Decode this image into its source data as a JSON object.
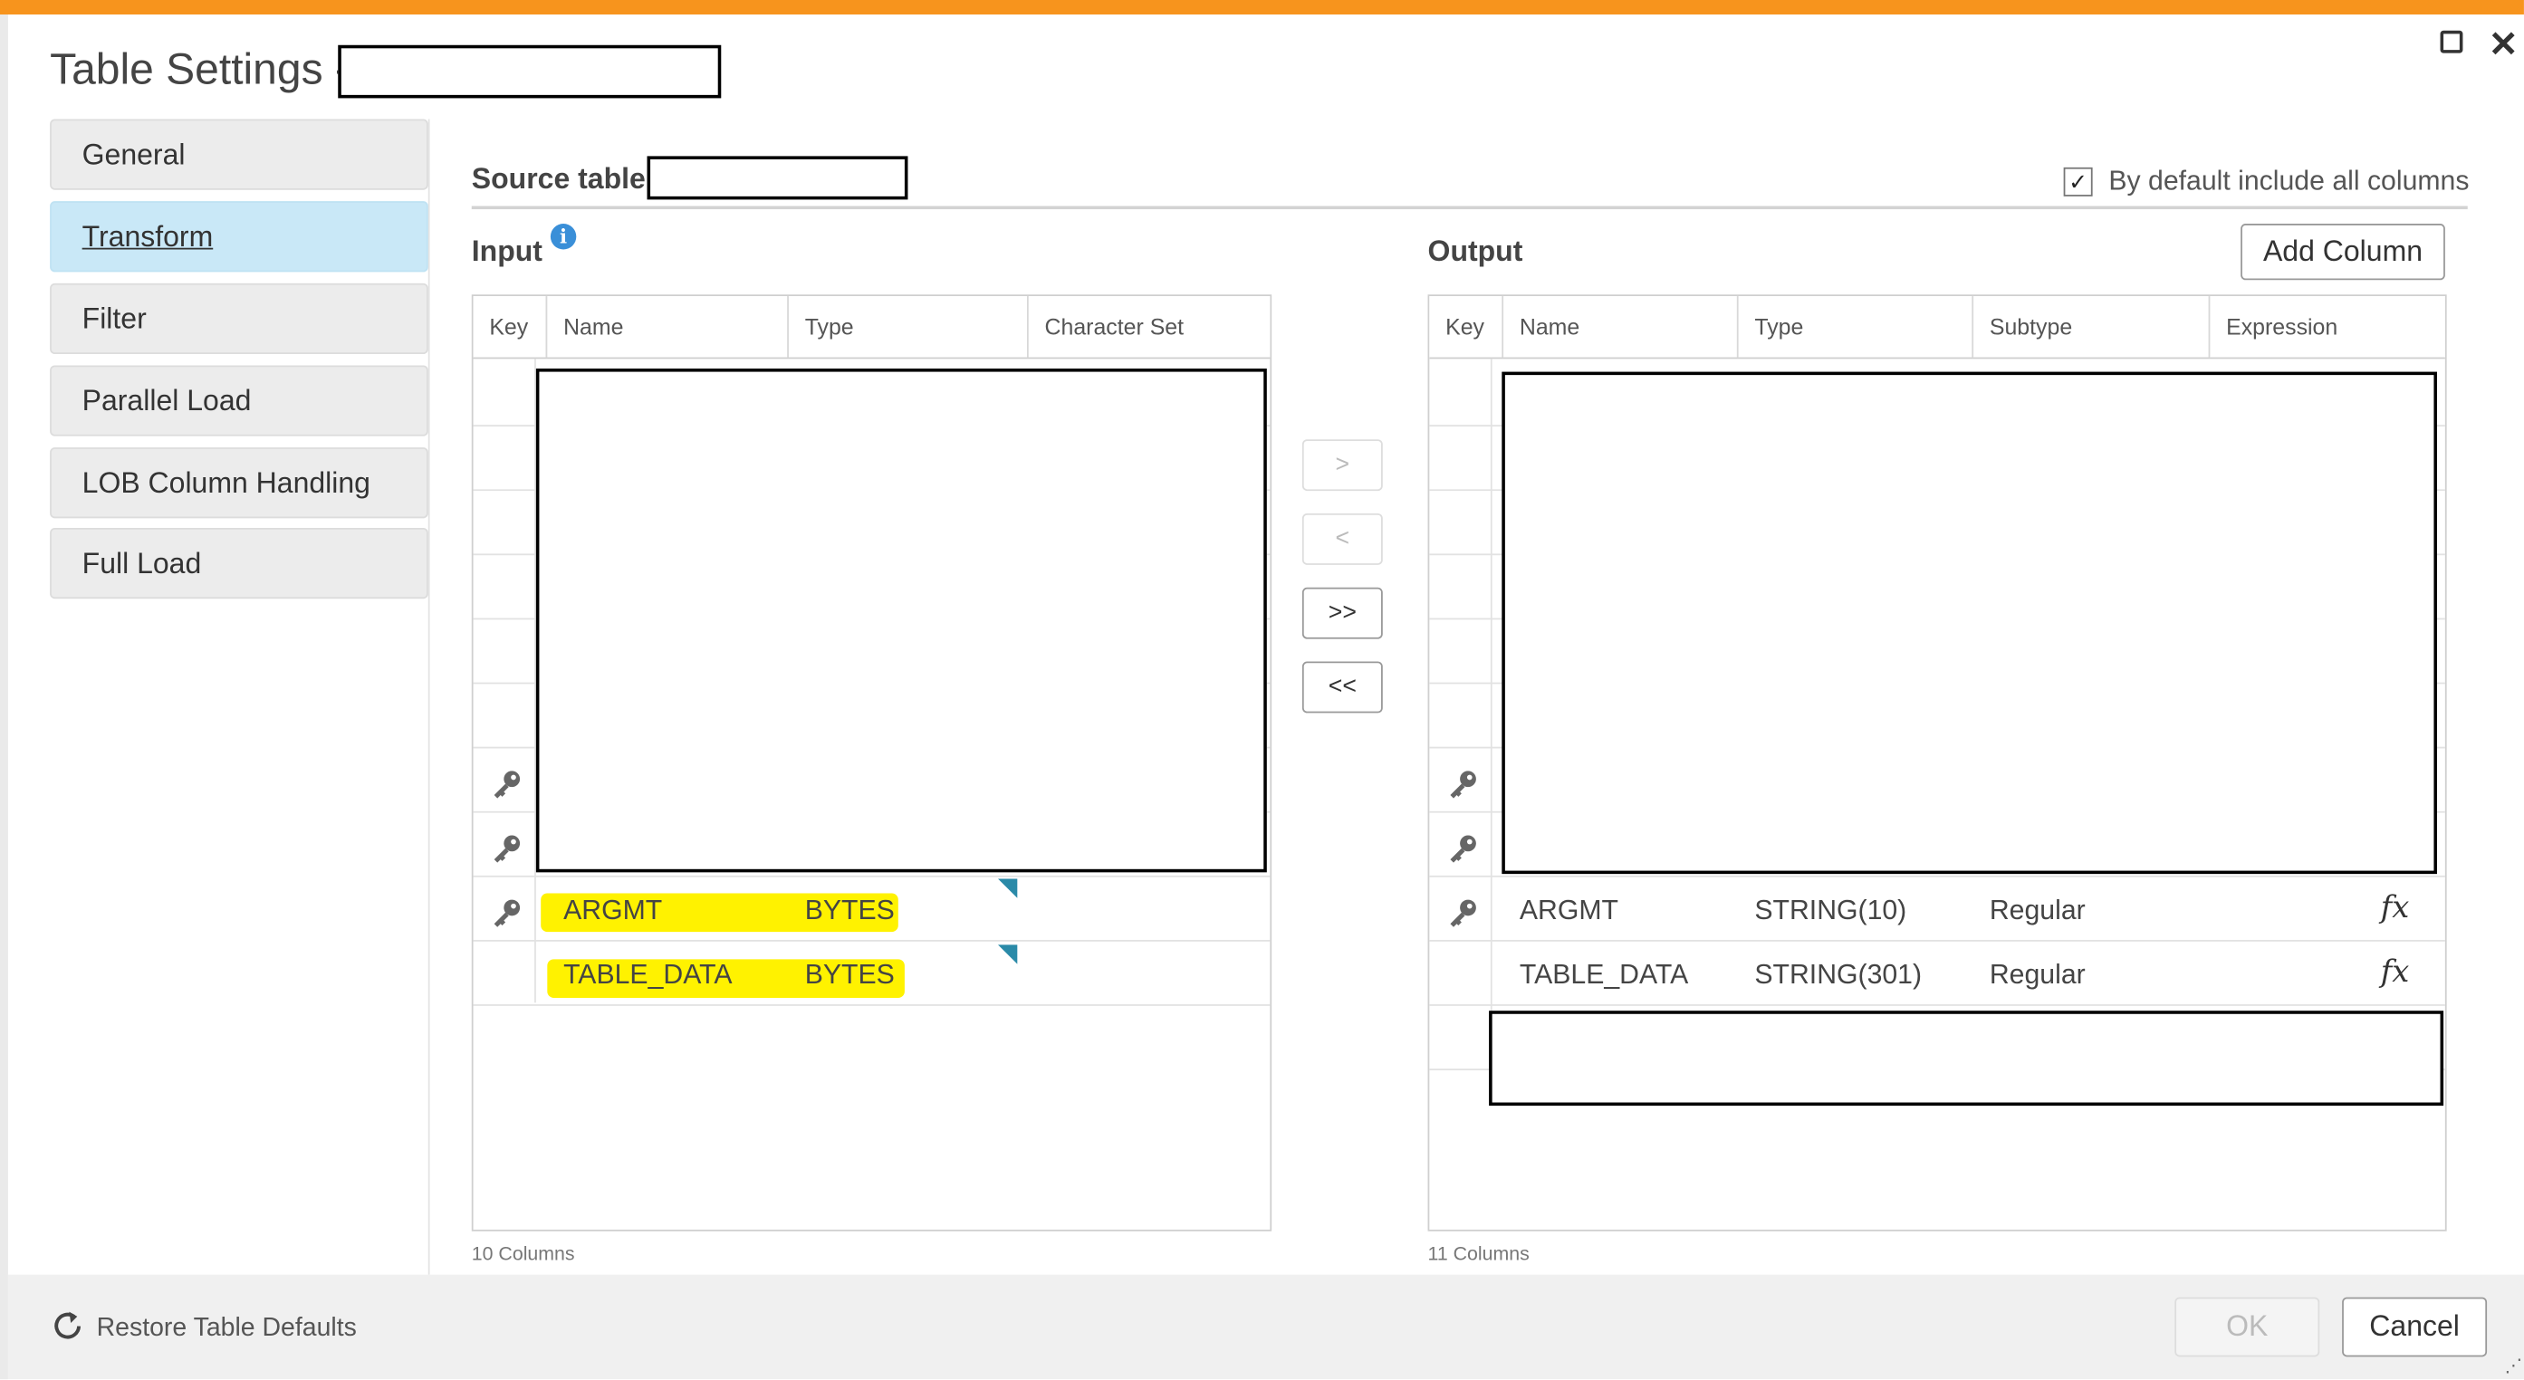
{
  "window": {
    "title": "Table Settings -",
    "restore_icon": "square-icon",
    "close_icon": "close-icon",
    "accent_color": "#f7941d"
  },
  "sidebar": {
    "items": [
      {
        "label": "General",
        "active": false
      },
      {
        "label": "Transform",
        "active": true
      },
      {
        "label": "Filter",
        "active": false
      },
      {
        "label": "Parallel Load",
        "active": false
      },
      {
        "label": "LOB Column Handling",
        "active": false
      },
      {
        "label": "Full Load",
        "active": false
      }
    ]
  },
  "source": {
    "label": "Source table :",
    "include_all_label": "By default include all columns",
    "include_all_checked": true
  },
  "input": {
    "title": "Input",
    "columns": [
      "Key",
      "Name",
      "Type",
      "Character Set"
    ],
    "rows": [
      {
        "key": true,
        "name": "ARGMT",
        "type": "BYTES"
      },
      {
        "key": false,
        "name": "TABLE_DATA",
        "type": "BYTES"
      }
    ],
    "count": "10 Columns"
  },
  "output": {
    "title": "Output",
    "add_column": "Add Column",
    "columns": [
      "Key",
      "Name",
      "Type",
      "Subtype",
      "Expression"
    ],
    "rows": [
      {
        "key": true,
        "name": "ARGMT",
        "type": "STRING(10)",
        "subtype": "Regular",
        "expr": "fx"
      },
      {
        "key": false,
        "name": "TABLE_DATA",
        "type": "STRING(301)",
        "subtype": "Regular",
        "expr": "fx"
      }
    ],
    "count": "11 Columns"
  },
  "move_buttons": {
    "move_right": ">",
    "move_left": "<",
    "move_all_right": ">>",
    "move_all_left": "<<"
  },
  "footer": {
    "restore_label": "Restore Table Defaults",
    "ok": "OK",
    "cancel": "Cancel"
  }
}
